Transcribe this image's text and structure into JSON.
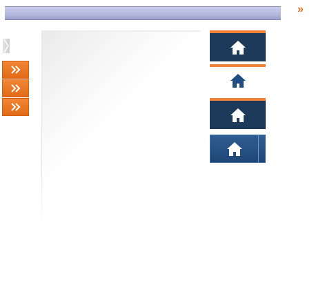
{
  "colors": {
    "header_bar": "#b4bade",
    "accent_orange": "#e8701f",
    "tile_dark": "#1e3a5a",
    "tile_blue": "#2f5e92"
  },
  "icons": {
    "top": "double-chevron-right-icon",
    "side_arrow": "chevron-right-icon",
    "orange_buttons": [
      "double-chevron-right-icon",
      "double-chevron-right-icon",
      "double-chevron-right-icon"
    ],
    "tiles": [
      "home-icon",
      "home-icon",
      "home-icon",
      "home-icon"
    ]
  }
}
